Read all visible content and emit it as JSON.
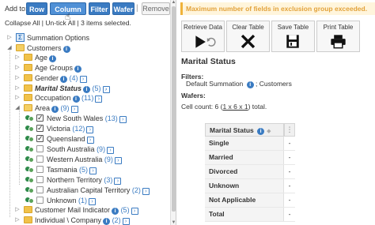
{
  "topbar": {
    "add_to_label": "Add to:",
    "row_label": "Row",
    "column_label": "Column",
    "filter_label": "Filter",
    "wafer_label": "Wafer",
    "separator": "|",
    "remove_label": "Remove"
  },
  "collapse": {
    "collapse_all": "Collapse All",
    "sep1": " | ",
    "untick_all": "Un-tick All",
    "sep2": " | ",
    "items_selected": "3 items selected."
  },
  "tree": {
    "summation_options": "Summation Options",
    "customers": "Customers",
    "age": "Age",
    "age_groups": "Age Groups",
    "gender": "Gender",
    "gender_count": "(4)",
    "marital_status": "Marital Status",
    "marital_count": "(5)",
    "occupation": "Occupation",
    "occupation_count": "(11)",
    "area": "Area",
    "area_count": "(9)",
    "areas": [
      {
        "name": "New South Wales",
        "count": "(13)",
        "checked": true
      },
      {
        "name": "Victoria",
        "count": "(12)",
        "checked": true
      },
      {
        "name": "Queensland",
        "count": "",
        "checked": true
      },
      {
        "name": "South Australia",
        "count": "(9)",
        "checked": false
      },
      {
        "name": "Western Australia",
        "count": "(9)",
        "checked": false
      },
      {
        "name": "Tasmania",
        "count": "(5)",
        "checked": false
      },
      {
        "name": "Northern Territory",
        "count": "(3)",
        "checked": false
      },
      {
        "name": "Australian Capital Territory",
        "count": "(2)",
        "checked": false
      },
      {
        "name": "Unknown",
        "count": "(1)",
        "checked": false
      }
    ],
    "customer_mail_indicator": "Customer Mail Indicator",
    "customer_mail_count": "(5)",
    "individual_company": "Individual \\ Company",
    "individual_company_count": "(2)"
  },
  "right": {
    "warning": "Maximum number of fields in exclusion group exceeded.",
    "tools": {
      "retrieve": "Retrieve Data",
      "clear": "Clear Table",
      "save": "Save Table",
      "print": "Print Table"
    },
    "title": "Marital Status",
    "filters_heading": "Filters:",
    "filters_value": "Default Summation",
    "filters_value2": "; Customers",
    "wafers_heading": "Wafers:",
    "cell_count_prefix": "Cell count: 6 (",
    "cell_count_link": "1 x 6 x 1",
    "cell_count_suffix": ") total.",
    "table": {
      "header": "Marital Status",
      "rows": [
        {
          "label": "Single",
          "value": "-"
        },
        {
          "label": "Married",
          "value": "-"
        },
        {
          "label": "Divorced",
          "value": "-"
        },
        {
          "label": "Unknown",
          "value": "-"
        },
        {
          "label": "Not Applicable",
          "value": "-"
        },
        {
          "label": "Total",
          "value": "-"
        }
      ]
    }
  },
  "colors": {
    "accent": "#3a7bc2",
    "warning_text": "#e2a23a",
    "warning_bg": "#fff5dc",
    "group_icon": "#2e8a4a"
  }
}
